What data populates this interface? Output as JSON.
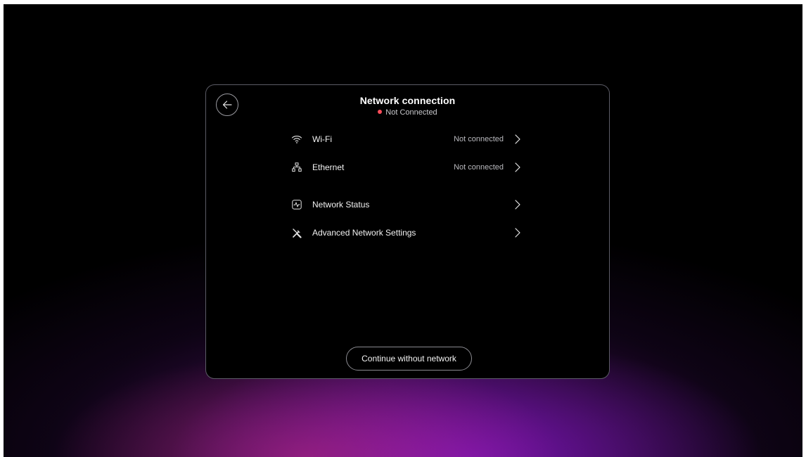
{
  "dialog": {
    "title": "Network connection",
    "status_text": "Not Connected",
    "status_color": "#ff4d5a"
  },
  "back_button": {
    "icon": "arrow-left-icon"
  },
  "connections": [
    {
      "icon": "wifi-icon",
      "label": "Wi-Fi",
      "value": "Not connected"
    },
    {
      "icon": "ethernet-icon",
      "label": "Ethernet",
      "value": "Not connected"
    }
  ],
  "settings": [
    {
      "icon": "activity-icon",
      "label": "Network Status"
    },
    {
      "icon": "tools-icon",
      "label": "Advanced Network Settings"
    }
  ],
  "continue_button": {
    "label": "Continue without network"
  },
  "colors": {
    "background": "#000000",
    "accent_pink": "#be2882",
    "accent_purple": "#8214c8"
  }
}
